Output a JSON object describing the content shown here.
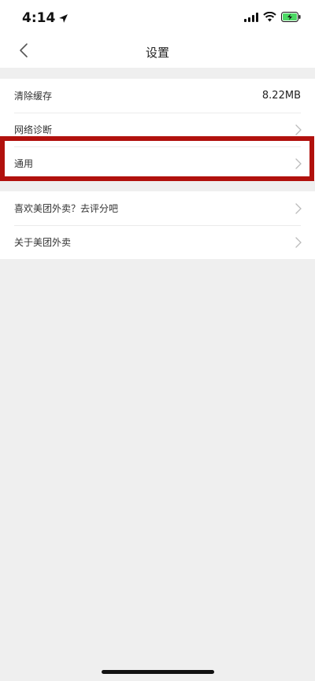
{
  "status_bar": {
    "time": "4:14"
  },
  "nav": {
    "title": "设置"
  },
  "group1": {
    "rows": [
      {
        "label": "清除缓存",
        "value": "8.22MB"
      },
      {
        "label": "网络诊断"
      },
      {
        "label": "通用"
      }
    ]
  },
  "group2": {
    "rows": [
      {
        "label": "喜欢美团外卖？去评分吧"
      },
      {
        "label": "关于美团外卖"
      }
    ]
  },
  "colors": {
    "highlight_border": "#b1110d",
    "background": "#efefef"
  }
}
